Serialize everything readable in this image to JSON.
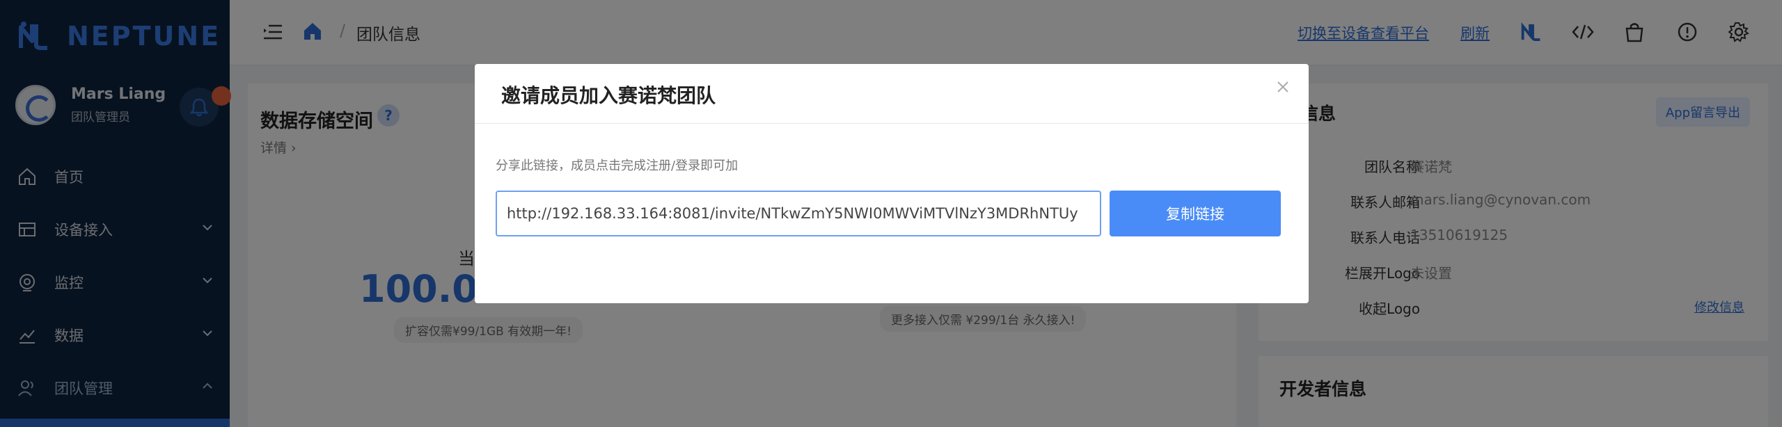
{
  "app": {
    "brand": "NEPTUNE",
    "user_name": "Mars Liang",
    "user_role": "团队管理员"
  },
  "sidebar": {
    "items": [
      {
        "label": "首页",
        "icon": "home-icon"
      },
      {
        "label": "设备接入",
        "icon": "device-icon"
      },
      {
        "label": "监控",
        "icon": "monitor-icon"
      },
      {
        "label": "数据",
        "icon": "chart-icon"
      },
      {
        "label": "团队管理",
        "icon": "team-icon"
      }
    ]
  },
  "header": {
    "breadcrumb_sep": "/",
    "breadcrumb": "团队信息",
    "switch_link": "切换至设备查看平台",
    "refresh_link": "刷新"
  },
  "storage": {
    "title": "数据存储空间",
    "details": "详情",
    "current_label": "当",
    "value": "100.00",
    "promo": "扩容仅需¥99/1GB 有效期一年!",
    "promo_right": "更多接入仅需 ¥299/1台 永久接入!"
  },
  "team_info": {
    "title": "队信息",
    "export_button": "App留言导出",
    "rows": [
      {
        "label": "团队名称",
        "value": "赛诺梵"
      },
      {
        "label": "联系人邮箱",
        "value": "mars.liang@cynovan.com"
      },
      {
        "label": "联系人电话",
        "value": "13510619125"
      },
      {
        "label": "栏展开Logo",
        "value": "未设置"
      },
      {
        "label": "收起Logo",
        "value": ""
      }
    ],
    "edit_link": "修改信息"
  },
  "developer": {
    "title": "开发者信息"
  },
  "modal": {
    "title": "邀请成员加入赛诺梵团队",
    "hint": "分享此链接，成员点击完成注册/登录即可加",
    "invite_url": "http://192.168.33.164:8081/invite/NTkwZmY5NWI0MWViMTVlNzY3MDRhNTUy",
    "copy_button": "复制链接"
  },
  "colors": {
    "accent": "#2f6fd6",
    "sidebar_bg": "#0f2440",
    "button": "#4a8cf7",
    "badge": "#e8623a"
  }
}
